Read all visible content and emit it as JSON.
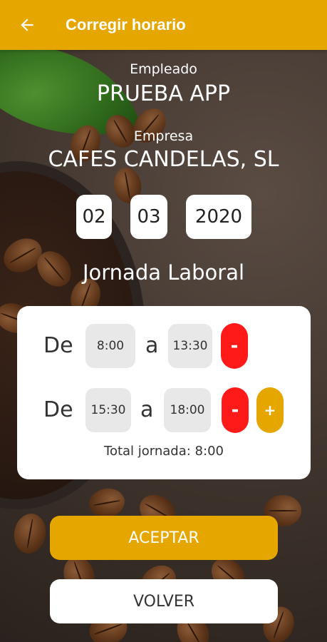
{
  "appbar": {
    "title": "Corregir horario",
    "back_icon": "arrow-left-icon"
  },
  "employee": {
    "label": "Empleado",
    "value": "PRUEBA APP"
  },
  "company": {
    "label": "Empresa",
    "value": "CAFES CANDELAS, SL"
  },
  "date": {
    "day": "02",
    "month": "03",
    "year": "2020"
  },
  "section_heading": "Jornada Laboral",
  "shifts": [
    {
      "from_label": "De",
      "from": "8:00",
      "to_label": "a",
      "to": "13:30"
    },
    {
      "from_label": "De",
      "from": "15:30",
      "to_label": "a",
      "to": "18:00"
    }
  ],
  "controls": {
    "remove_symbol": "-",
    "add_symbol": "+"
  },
  "total": "Total jornada: 8:00",
  "buttons": {
    "accept": "ACEPTAR",
    "back": "VOLVER"
  },
  "colors": {
    "accent": "#e6a600",
    "danger": "#ff1a1a",
    "card": "#ffffff"
  }
}
